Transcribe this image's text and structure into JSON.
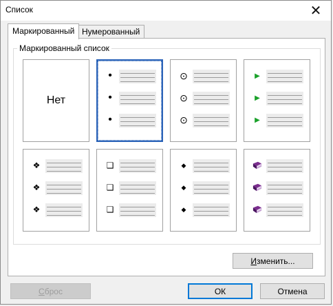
{
  "window": {
    "title": "Список",
    "close_glyph": "✕"
  },
  "tabs": [
    {
      "label": "Маркированный",
      "active": true
    },
    {
      "label": "Нумерованный",
      "active": false
    }
  ],
  "group": {
    "label": "Маркированный список"
  },
  "styles": [
    {
      "name": "none",
      "label": "Нет",
      "selected": false
    },
    {
      "name": "dot",
      "bullet": "•",
      "selected": true
    },
    {
      "name": "circle-dot",
      "bullet": "⊙",
      "selected": false
    },
    {
      "name": "green-arrow",
      "bullet": "▶",
      "color": "#1aa12a",
      "selected": false
    },
    {
      "name": "diamond-cross",
      "bullet": "❖",
      "selected": false
    },
    {
      "name": "shadow-square",
      "bullet": "❑",
      "selected": false
    },
    {
      "name": "small-diamond",
      "bullet": "◆",
      "selected": false
    },
    {
      "name": "book",
      "bullet": "book-icon",
      "color": "#7b2d8e",
      "selected": false
    }
  ],
  "buttons": {
    "change": {
      "label": "Изменить...",
      "underline": "И"
    },
    "reset": {
      "label": "Сброс",
      "underline": "С",
      "disabled": true
    },
    "ok": {
      "label": "ОК"
    },
    "cancel": {
      "label": "Отмена"
    }
  }
}
